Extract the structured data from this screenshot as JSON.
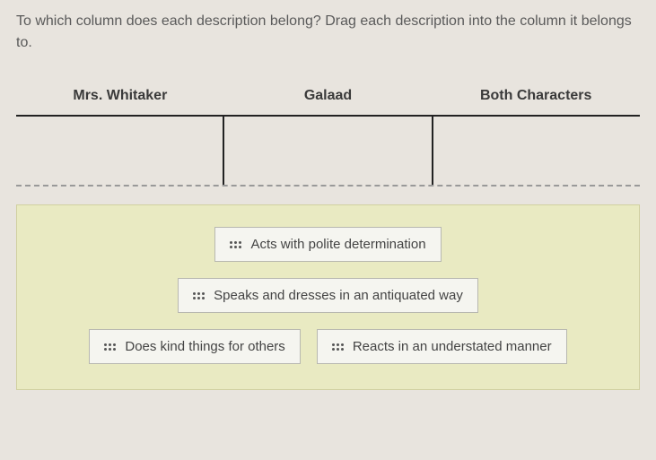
{
  "instructions": "To which column does each description belong? Drag each description into the column it belongs to.",
  "columns": {
    "col1": "Mrs. Whitaker",
    "col2": "Galaad",
    "col3": "Both Characters"
  },
  "chips": {
    "c1": "Acts with polite determination",
    "c2": "Speaks and dresses in an antiquated way",
    "c3": "Does kind things for others",
    "c4": "Reacts in an understated manner"
  }
}
